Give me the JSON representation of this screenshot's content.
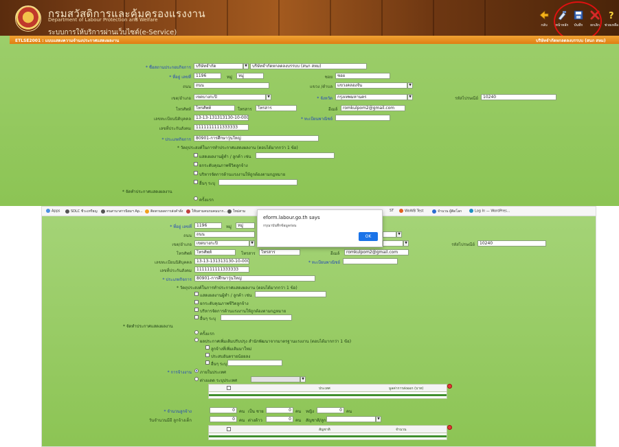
{
  "header": {
    "dept_name_th": "กรมสวัสดิการและคุ้มครองแรงงาน",
    "dept_name_en_1": "Department of Labour Protection and Welfare",
    "dept_name_en_2": "",
    "system_name": "ระบบการให้บริการผ่านเว็บไซต์(e-Service)",
    "program_title": "ETLSE2001 : แบบแสดงความจำนงประกาศแสดงผลงาน",
    "user_info": "บริษัทจำกัดหกลดลงบรรบบ (สนก สหม)",
    "toolbar": [
      {
        "icon": "back-arrow-icon",
        "label": "กลับ"
      },
      {
        "icon": "home-icon",
        "label": "หน้าหลัก"
      },
      {
        "icon": "save-disk-icon",
        "label": "บันทึก"
      },
      {
        "icon": "cancel-x-icon",
        "label": "ยกเลิก"
      },
      {
        "icon": "help-icon",
        "label": "ช่วยเหลือ"
      }
    ]
  },
  "form_top": {
    "company_label": "* ชื่อสถานประกอบกิจการ",
    "company_type": "บริษัทจำกัด",
    "company_name": "บริษัทจำกัดหกลดลงบรรบบ (สนก สหม)",
    "house_no_label": "* ที่อยู่ เลขที่",
    "house_no": "1196",
    "moo_label": "หมู่",
    "moo": "หมู่",
    "soi_label": "ซอย",
    "soi": "ซอย",
    "road_label": "ถนน",
    "road": "ถนน",
    "subdistrict_label": "แขวง /ตำบล",
    "subdistrict": "แขวงคลองจั่น",
    "district_label": "เขต/อำเภอ",
    "district": "เขตบางกะปิ",
    "province_label": "* จังหวัด",
    "province": "กรุงเทพมหานคร",
    "postcode_label": "รหัสไปรษณีย์",
    "postcode": "10240",
    "phone_label": "โทรศัพท์",
    "phone": "โทรศัพท์",
    "fax_label": "โทรสาร",
    "fax": "โทรสาร",
    "email_label": "อีเมล์",
    "email": "romkulpom2@gmail.com",
    "corp_reg_label": "เลขทะเบียนนิติบุคคล",
    "corp_reg": "13-13-131313130-10-0001",
    "license_label": "* ทะเบียนพาณิชย์",
    "license": "",
    "ss_no_label": "เลขที่ประกันสังคม",
    "ss_no": "1111111111333333",
    "business_type_label": "* ประเภทกิจการ",
    "business_type": "80901-การศึกษาวุ่นใหญ่",
    "objective_label": "* วัตถุประสงค์ในการทำประกาศแสดงผลงาน (ตอบได้มากกว่า 1 ข้อ)",
    "objectives": [
      "แสดงผลงานผู้ทำ / ลูกค้า เช่น",
      "ยกระดับคุณภาพชีวิตลูกจ้าง",
      "บริหารจัดการด้านแรงงานให้ถูกต้องตามกฎหมาย",
      "อื่นๆ ระบุ"
    ],
    "announce_label": "* จัดทำประกาศแสดงผลงาน",
    "announce_options": [
      "ครั้งแรก"
    ]
  },
  "bookmarks": [
    {
      "label": "Apps",
      "color": "#4a90e2"
    },
    {
      "label": "SDLC ชีวะเหรียญ",
      "color": "#555555"
    },
    {
      "label": "ตนสานาสารนิยมฯ Ap...",
      "color": "#555555"
    },
    {
      "label": "ติดตามผลการส่งคำสั่ง",
      "color": "#f0a020"
    },
    {
      "label": "ให้บสามคนรมคมมาก...",
      "color": "#c04040"
    },
    {
      "label": "ใหม่สาม",
      "color": "#555555"
    },
    {
      "label": "ST",
      "color": "#555555"
    },
    {
      "label": "WoWB Test",
      "color": "#e06020"
    },
    {
      "label": "จำนวน ผู้ติดโลก",
      "color": "#2b6cd0"
    },
    {
      "label": "Log In — WordPres...",
      "color": "#2190c0"
    }
  ],
  "dialog": {
    "title": "eform.labour.go.th says",
    "message": "กรุณาบันทึกข้อมูลก่อน",
    "ok_label": "OK"
  },
  "form_bottom": {
    "house_no_label": "* ที่อยู่ เลขที่",
    "house_no": "1196",
    "moo_label": "หมู่",
    "moo": "หมู่",
    "road_label": "ถนน",
    "road": "ถนน",
    "district_label": "เขต/อำเภอ",
    "district": "เขตบางกะปิ",
    "postcode_label": "รหัสไปรษณีย์",
    "postcode": "10240",
    "phone_label": "โทรศัพท์",
    "phone": "โทรศัพท์",
    "fax_label": "โทรสาร",
    "fax": "โทรสาร",
    "email_label": "อีเมล์",
    "email": "romkulpom2@gmail.com",
    "corp_reg_label": "เลขทะเบียนนิติบุคคล",
    "corp_reg": "13-13-131313130-10-0001",
    "license_label": "* ทะเบียนพาณิชย์",
    "ss_no_label": "เลขที่ประกันสังคม",
    "ss_no": "1111111111333333",
    "business_type_label": "* ประเภทกิจการ",
    "business_type": "80901-การศึกษาวุ่นใหญ่",
    "objective_label": "* วัตถุประสงค์ในการทำประกาศแสดงผลงาน (ตอบได้มากกว่า 1 ข้อ)",
    "objectives": [
      "แสดงผลงานผู้ทำ / ลูกค้า เช่น",
      "ยกระดับคุณภาพชีวิตลูกจ้าง",
      "บริหารจัดการด้านแรงงานให้ถูกต้องตามกฎหมาย",
      "อื่นๆ ระบุ"
    ],
    "announce_label": "* จัดทำประกาศแสดงผลงาน",
    "announce_first": "ครั้งแรก",
    "announce_update": "ผลประกาศเพิ่มเติมปรับปรุง สำนักพัฒนาจากมาตรฐานแรงงาน (ตอบได้มากกว่า 1 ข้อ)",
    "update_options": [
      "ลูกจ้างที่เพิ่มเติมมาใหม่",
      "ประสบอันตรายน้อยลง",
      "อื่นๆ ระบุ"
    ],
    "employ_label": "* การจ้างงาน",
    "employ_opt1": "ภายในประเทศ",
    "employ_opt2": "ต่างแดด ระบุประเทศ",
    "table1": {
      "col1": "ประเทศ",
      "col2": "มูลค่าการส่งออก (บาท)"
    },
    "count_label": "* จำนวนลูกจ้าง",
    "count_values": [
      "0",
      "0",
      "0",
      "0"
    ],
    "count_units": [
      "คน",
      "เป็น ชาย",
      "คน",
      "หญิง",
      "คน"
    ],
    "count_unit_end": "คน",
    "age_label": "วันจำนวนมีอี ลูกจ้างเด็ก",
    "age_value": "0",
    "age_unit": "คน",
    "foreign_label": "ต่างด้าว",
    "foreign_value": "0",
    "foreign_unit": "คน",
    "nationality_label": "สัญชาติ/ลูกคน",
    "table2": {
      "col1": "สัญชาติ",
      "col2": "จำนวน"
    }
  }
}
